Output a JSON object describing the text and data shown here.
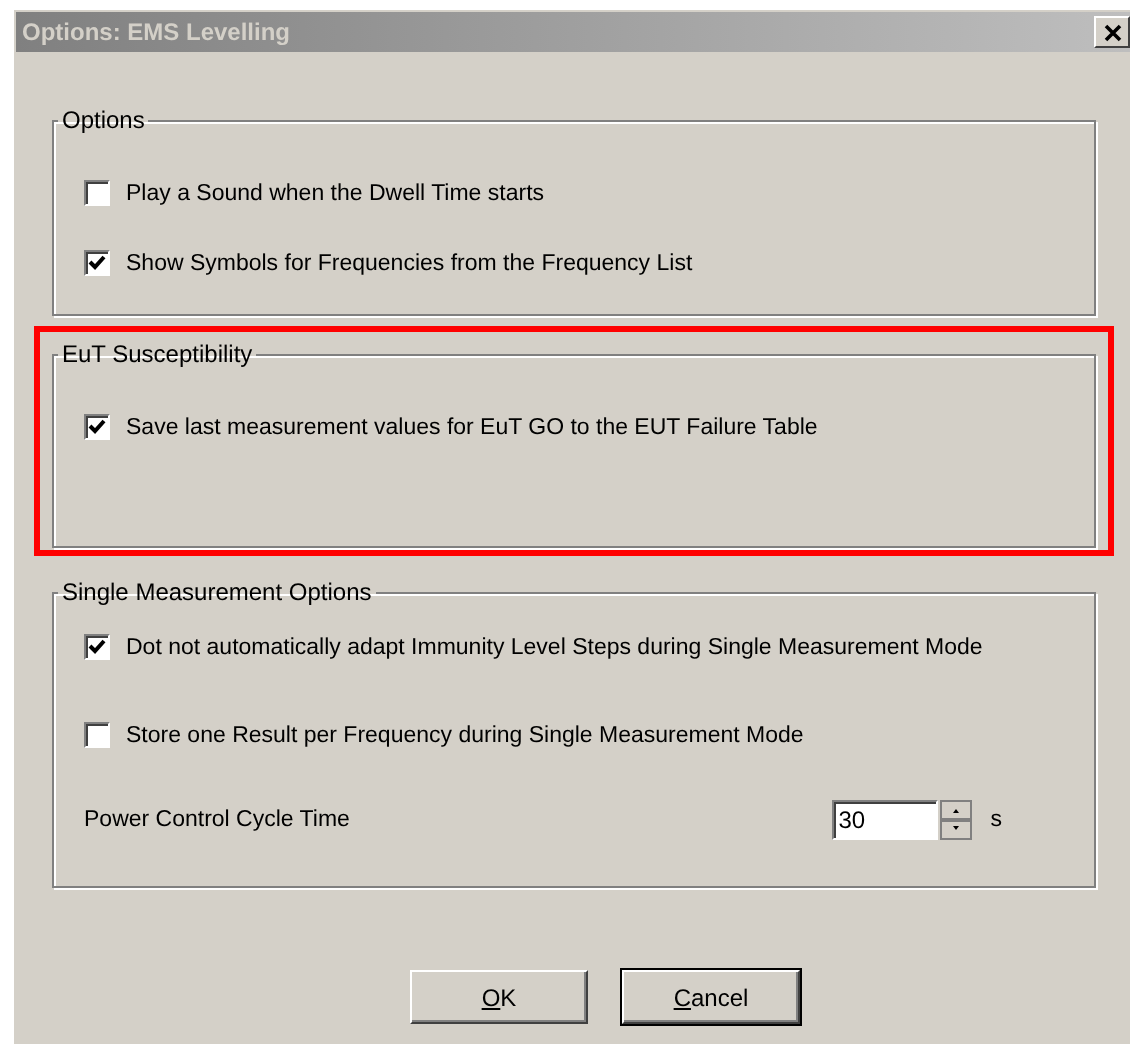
{
  "window": {
    "title": "Options: EMS Levelling"
  },
  "groups": [
    {
      "title": "Options",
      "highlighted": false,
      "items": [
        {
          "kind": "checkbox",
          "label": "Play a Sound when the Dwell Time starts",
          "checked": false
        },
        {
          "kind": "checkbox",
          "label": "Show Symbols for Frequencies from the Frequency List",
          "checked": true
        }
      ]
    },
    {
      "title": "EuT Susceptibility",
      "highlighted": true,
      "items": [
        {
          "kind": "checkbox",
          "label": "Save last measurement values for EuT GO to the EUT Failure Table",
          "checked": true
        }
      ]
    },
    {
      "title": "Single Measurement Options",
      "highlighted": false,
      "items": [
        {
          "kind": "checkbox",
          "label": "Dot not automatically adapt Immunity Level Steps during Single Measurement Mode",
          "checked": true
        },
        {
          "kind": "checkbox",
          "label": "Store one Result per Frequency during Single Measurement Mode",
          "checked": false
        },
        {
          "kind": "spin",
          "label": "Power Control Cycle Time",
          "value": "30",
          "unit": "s"
        }
      ]
    }
  ],
  "buttons": [
    {
      "label": "OK",
      "default": false,
      "mnemonic_underlined": true
    },
    {
      "label": "Cancel",
      "default": true,
      "mnemonic_underlined": true
    }
  ]
}
